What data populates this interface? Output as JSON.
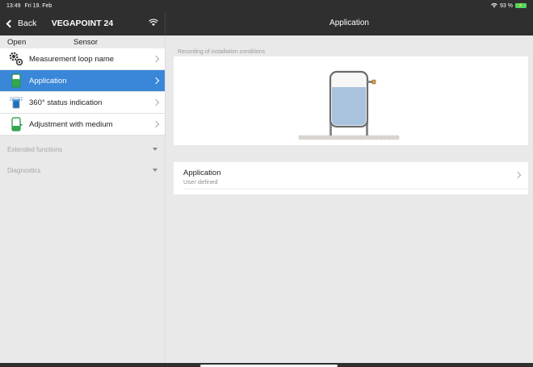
{
  "status": {
    "time": "13:49",
    "date": "Fri 19. Feb",
    "battery_percent": "93 %"
  },
  "nav": {
    "back_label": "Back",
    "device_name": "VEGAPOINT 24",
    "page_title": "Application"
  },
  "sidebar": {
    "header_open": "Open",
    "header_sensor": "Sensor",
    "items": [
      {
        "label": "Measurement loop name",
        "icon": "gears-icon"
      },
      {
        "label": "Application",
        "icon": "tank-icon",
        "active": true
      },
      {
        "label": "360° status indication",
        "icon": "status-light-icon"
      },
      {
        "label": "Adjustment with medium",
        "icon": "tank-medium-icon"
      }
    ],
    "sections": [
      {
        "label": "Extended functions"
      },
      {
        "label": "Diagnostics"
      }
    ]
  },
  "main": {
    "section_label": "Recording of installation conditions",
    "application_row": {
      "title": "Application",
      "value": "User defined"
    }
  },
  "colors": {
    "accent": "#3a87d9",
    "bar": "#2f2f2f",
    "liquid": "#a9c3df",
    "battery": "#4cd964"
  }
}
